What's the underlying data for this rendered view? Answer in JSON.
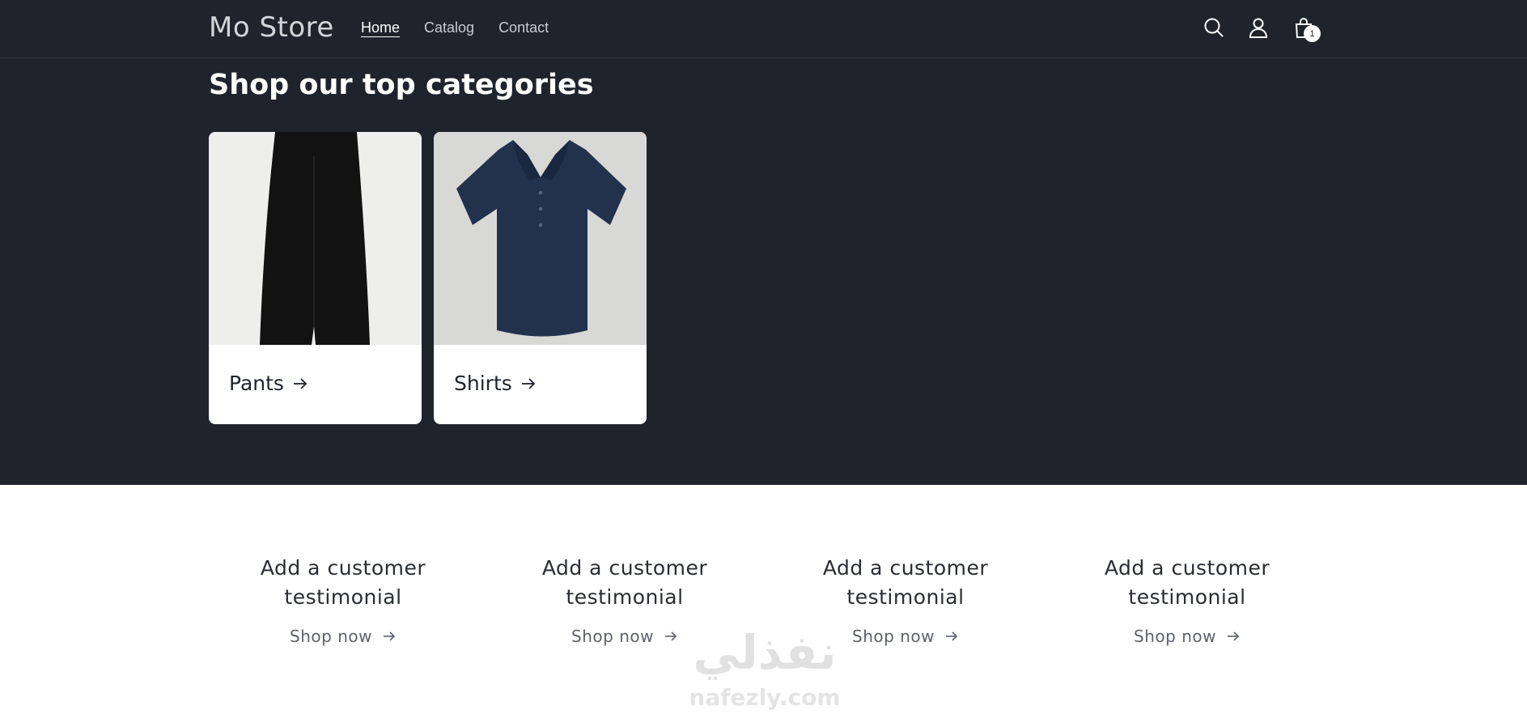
{
  "header": {
    "logo": "Mo Store",
    "nav": [
      {
        "label": "Home",
        "active": true
      },
      {
        "label": "Catalog",
        "active": false
      },
      {
        "label": "Contact",
        "active": false
      }
    ],
    "icons": [
      "search-icon",
      "account-icon",
      "cart-icon"
    ],
    "cart_count": "1"
  },
  "categories": {
    "title": "Shop our top categories",
    "items": [
      {
        "label": "Pants",
        "image": "black wide-leg pants"
      },
      {
        "label": "Shirts",
        "image": "navy short-sleeve polo shirt"
      }
    ]
  },
  "testimonials": [
    {
      "title": "Add a customer testimonial",
      "link": "Shop now"
    },
    {
      "title": "Add a customer testimonial",
      "link": "Shop now"
    },
    {
      "title": "Add a customer testimonial",
      "link": "Shop now"
    },
    {
      "title": "Add a customer testimonial",
      "link": "Shop now"
    }
  ],
  "watermark": {
    "arabic": "نفذلي",
    "latin": "nafezly.com"
  },
  "colors": {
    "header_bg": "#1f232c",
    "section_bg": "#1f232c",
    "card_bg": "#ffffff",
    "text_dark": "#2a2d33"
  }
}
